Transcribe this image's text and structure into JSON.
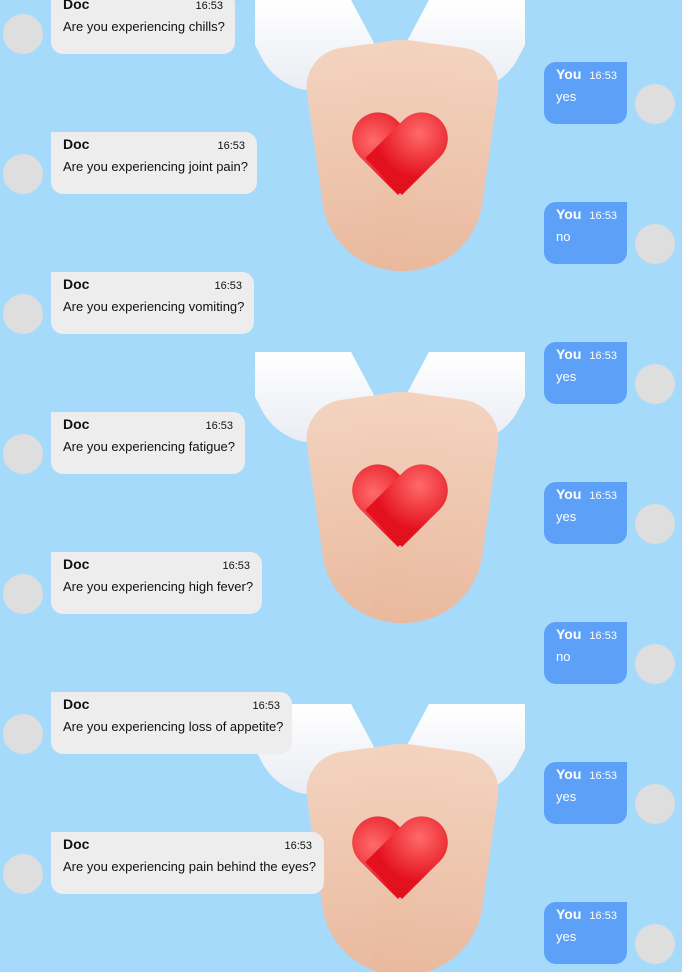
{
  "colors": {
    "background": "#a6dafa",
    "doc_bubble": "#ededed",
    "you_bubble": "#5ca0f7",
    "avatar": "#dedede"
  },
  "background_image": {
    "description_icon": "hands-holding-heart"
  },
  "messages": [
    {
      "sender": "Doc",
      "time": "16:53",
      "text": "Are you experiencing chills?"
    },
    {
      "sender": "You",
      "time": "16:53",
      "text": "yes"
    },
    {
      "sender": "Doc",
      "time": "16:53",
      "text": "Are you experiencing joint pain?"
    },
    {
      "sender": "You",
      "time": "16:53",
      "text": "no"
    },
    {
      "sender": "Doc",
      "time": "16:53",
      "text": "Are you experiencing vomiting?"
    },
    {
      "sender": "You",
      "time": "16:53",
      "text": "yes"
    },
    {
      "sender": "Doc",
      "time": "16:53",
      "text": "Are you experiencing fatigue?"
    },
    {
      "sender": "You",
      "time": "16:53",
      "text": "yes"
    },
    {
      "sender": "Doc",
      "time": "16:53",
      "text": "Are you experiencing high fever?"
    },
    {
      "sender": "You",
      "time": "16:53",
      "text": "no"
    },
    {
      "sender": "Doc",
      "time": "16:53",
      "text": "Are you experiencing loss of appetite?"
    },
    {
      "sender": "You",
      "time": "16:53",
      "text": "yes"
    },
    {
      "sender": "Doc",
      "time": "16:53",
      "text": "Are you experiencing pain behind the eyes?"
    },
    {
      "sender": "You",
      "time": "16:53",
      "text": "yes"
    }
  ]
}
